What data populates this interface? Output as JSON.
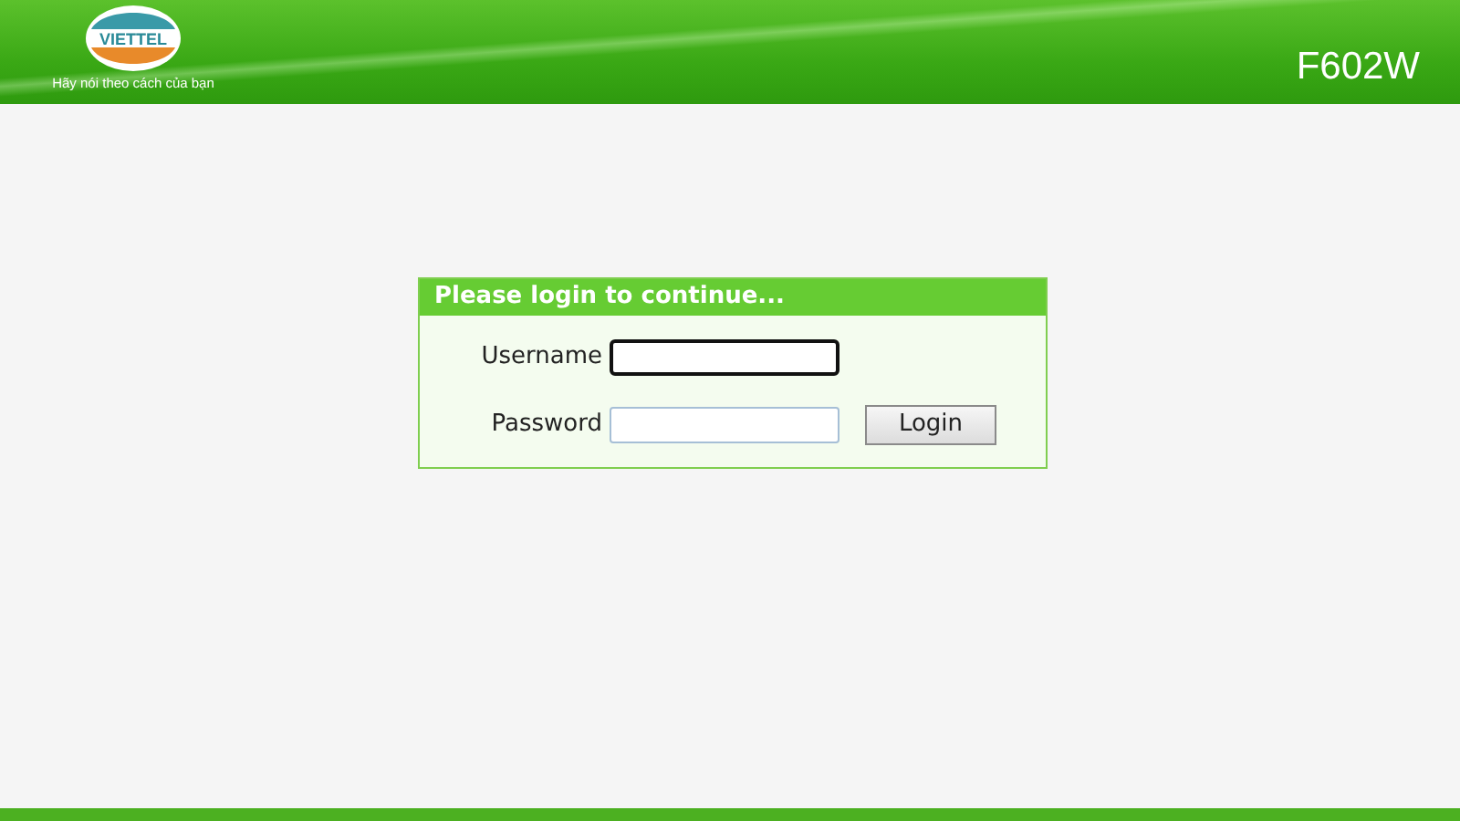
{
  "header": {
    "logo_text": "VIETTEL",
    "slogan": "Hãy nói theo cách của bạn",
    "model": "F602W"
  },
  "login": {
    "title": "Please login to continue...",
    "fields": [
      {
        "label": "Username",
        "focused": true
      },
      {
        "label": "Password",
        "focused": false
      }
    ],
    "button": "Login"
  }
}
